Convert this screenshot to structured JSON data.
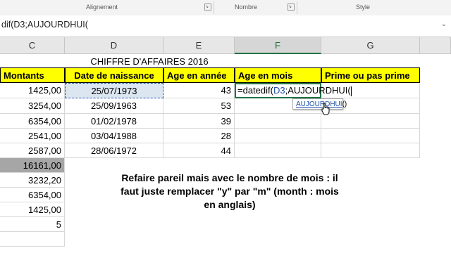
{
  "ribbon": {
    "groups": [
      "Alignement",
      "Nombre",
      "Style"
    ]
  },
  "formula_bar": {
    "text": "dif(D3;AUJOURDHUI("
  },
  "columns": [
    "C",
    "D",
    "E",
    "F",
    "G"
  ],
  "sheet_title": "CHIFFRE D'AFFAIRES 2016",
  "headers": {
    "montants": "Montants",
    "date_naissance": "Date de naissance",
    "age_annee": "Age en année",
    "age_mois": "Age en mois",
    "prime": "Prime ou pas prime"
  },
  "rows": [
    {
      "montant": "1425,00",
      "date": "25/07/1973",
      "age": "43"
    },
    {
      "montant": "3254,00",
      "date": "25/09/1963",
      "age": "53"
    },
    {
      "montant": "6354,00",
      "date": "01/02/1978",
      "age": "39"
    },
    {
      "montant": "2541,00",
      "date": "03/04/1988",
      "age": "28"
    },
    {
      "montant": "2587,00",
      "date": "28/06/1972",
      "age": "44"
    }
  ],
  "extra_rows": [
    "16161,00",
    "3232,20",
    "6354,00",
    "1425,00",
    "5"
  ],
  "edit_cell": {
    "prefix": "=datedif(",
    "ref": "D3",
    "suffix": ";AUJOURDHUI("
  },
  "tooltip": {
    "fn_name": "AUJOURDHUI",
    "parens": "()"
  },
  "instruction": "Refaire pareil mais avec le nombre de mois : il faut juste remplacer \"y\" par \"m\" (month : mois en anglais)",
  "colors": {
    "header_fill": "#ffff00",
    "selected_fill": "#dce6f1",
    "total_fill": "#a6a6a6",
    "accent": "#217346",
    "ref_blue": "#1f4fa8"
  }
}
